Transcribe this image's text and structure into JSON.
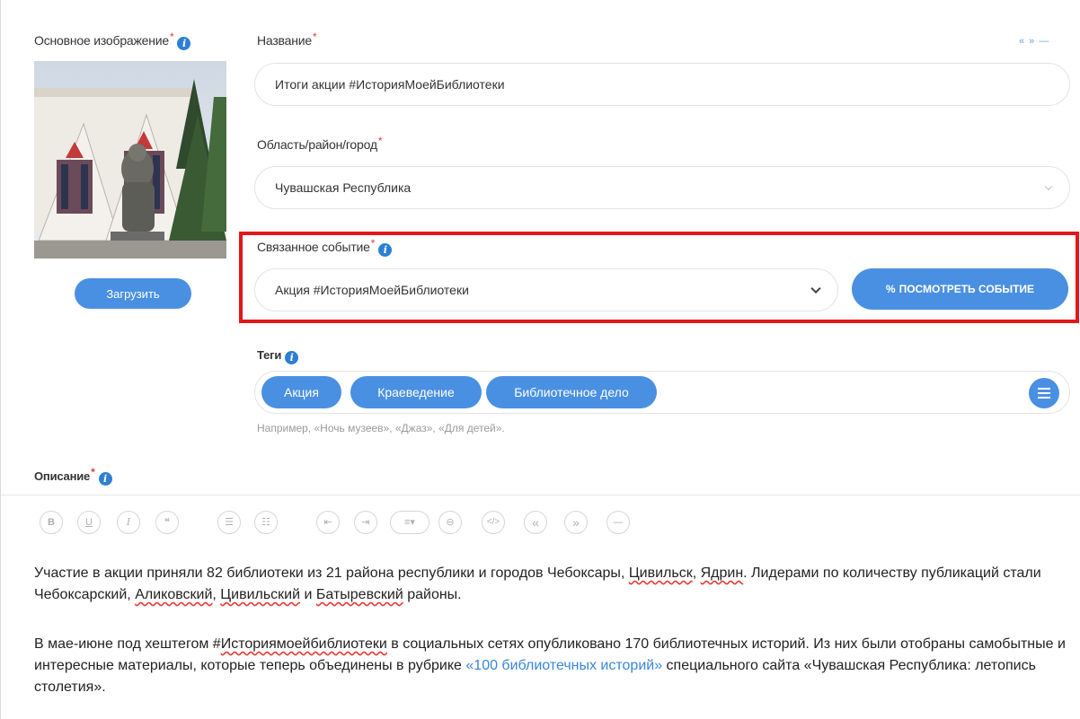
{
  "main_image": {
    "label": "Основное изображение",
    "upload_button": "Загрузить"
  },
  "title_field": {
    "label": "Название",
    "value": "Итоги акции #ИсторияМоейБиблиотеки"
  },
  "region_field": {
    "label": "Область/район/город",
    "value": "Чувашская Республика"
  },
  "event_field": {
    "label": "Связанное событие",
    "value": "Акция #ИсторияМоейБиблиотеки",
    "view_button": "ПОСМОТРЕТЬ СОБЫТИЕ"
  },
  "tags_field": {
    "label": "Теги",
    "tags": [
      "Акция",
      "Краеведение",
      "Библиотечное дело"
    ],
    "hint": "Например, «Ночь музеев», «Джаз», «Для детей»."
  },
  "description": {
    "label": "Описание"
  },
  "collapse_controls": "« » —",
  "required_mark": "*",
  "editor_toolbar": {
    "bold": "B",
    "underline": "U",
    "italic": "I",
    "quote_block": "❝",
    "bullet_list": "☰",
    "numbered_list": "☷",
    "outdent": "⇤",
    "indent": "⇥",
    "align": "≡▾",
    "link": "⊖",
    "code": "</>",
    "quote_open": "«",
    "quote_close": "»",
    "hr": "—"
  },
  "body_text": {
    "p1_a": "Участие в акции приняли 82 библиотеки из 21 района республики и городов Чебоксары, ",
    "p1_b": "Цивильск",
    "p1_c": ", ",
    "p1_d": "Ядрин",
    "p1_e": ". Лидерами по количеству публикаций стали Чебоксарский, ",
    "p1_f": "Аликовский",
    "p1_g": ", ",
    "p1_h": "Цивильский",
    "p1_i": " и ",
    "p1_j": "Батыревский",
    "p1_k": " районы.",
    "p2_a": "В мае-июне под хештегом #",
    "p2_b": "Историямоейбиблиотеки",
    "p2_c": " в социальных сетях опубликовано 170 библиотечных историй. Из них были отобраны самобытные и интересные материалы, которые теперь объединены в рубрике ",
    "p2_link": "«100 библиотечных историй»",
    "p2_d": " специального сайта «Чувашская Республика: летопись столетия»."
  },
  "colors": {
    "accent": "#4a90e2",
    "highlight": "#e3161b",
    "required": "#e53935"
  }
}
